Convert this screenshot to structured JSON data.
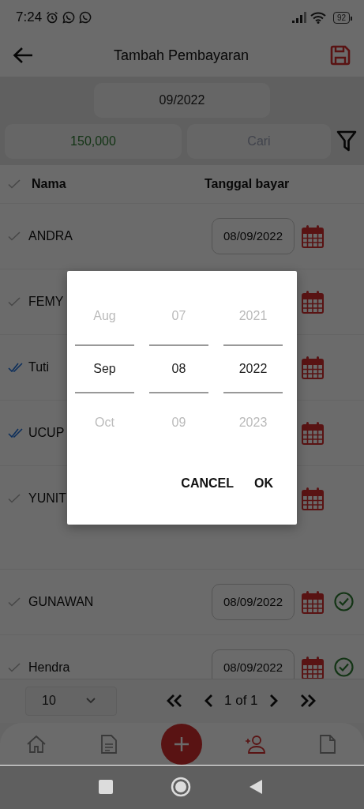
{
  "status_bar": {
    "time": "7:24",
    "battery": "92"
  },
  "app_bar": {
    "title": "Tambah Pembayaran"
  },
  "filters": {
    "period": "09/2022",
    "amount": "150,000",
    "search_placeholder": "Cari"
  },
  "table": {
    "columns": [
      "Nama",
      "Tanggal bayar"
    ],
    "rows": [
      {
        "name": "ANDRA",
        "date": "08/09/2022",
        "double_check": false,
        "confirmed": false
      },
      {
        "name": "FEMY",
        "double_check": false,
        "confirmed": false
      },
      {
        "name": "Tuti",
        "double_check": true,
        "confirmed": false
      },
      {
        "name": "UCUP",
        "double_check": true,
        "confirmed": false
      },
      {
        "name": "YUNIT",
        "double_check": false,
        "confirmed": false
      },
      {
        "kind": "spacer"
      },
      {
        "name": "GUNAWAN",
        "date": "08/09/2022",
        "double_check": false,
        "confirmed": true
      },
      {
        "name": "Hendra",
        "date": "08/09/2022",
        "double_check": false,
        "confirmed": true
      }
    ]
  },
  "pagination": {
    "page_size": "10",
    "page_info": "1 of 1"
  },
  "bottom_nav": {
    "items": [
      {
        "kind": "home",
        "selected": false
      },
      {
        "kind": "document",
        "selected": false
      },
      {
        "kind": "person",
        "selected": true
      },
      {
        "kind": "file",
        "selected": false
      }
    ]
  },
  "date_picker": {
    "columns": [
      {
        "prev": "Aug",
        "value": "Sep",
        "next": "Oct"
      },
      {
        "prev": "07",
        "value": "08",
        "next": "09"
      },
      {
        "prev": "2021",
        "value": "2022",
        "next": "2023"
      }
    ],
    "buttons": [
      "CANCEL",
      "OK"
    ]
  }
}
